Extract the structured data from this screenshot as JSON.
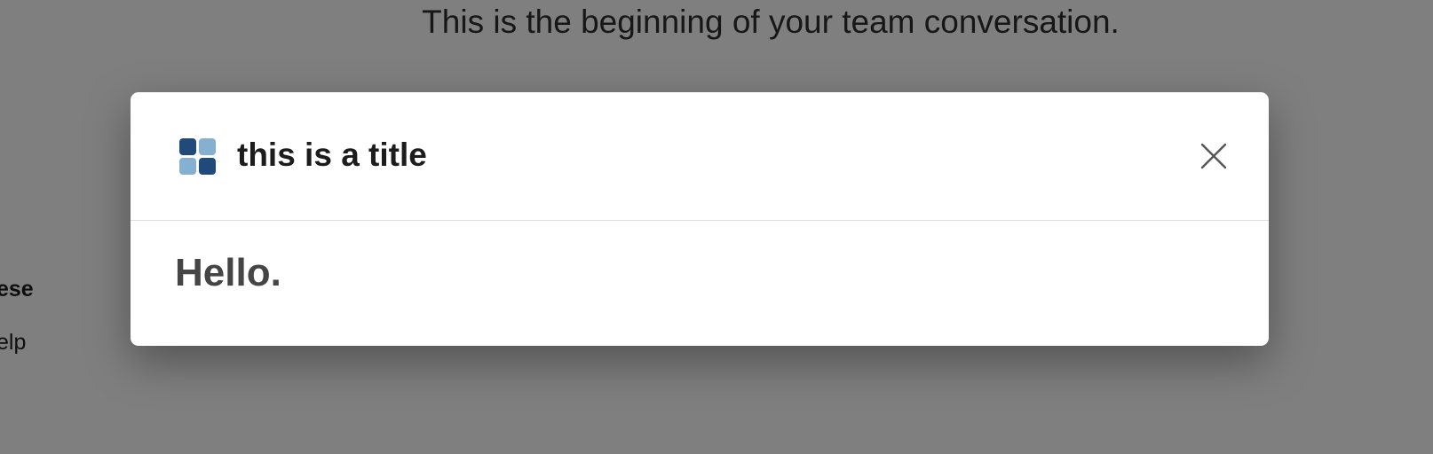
{
  "background": {
    "heading": "This is the beginning of your team conversation.",
    "snippets": [
      "ese",
      "elp"
    ]
  },
  "modal": {
    "icon": "app-grid-icon",
    "title": "this is a title",
    "close_icon": "close-icon",
    "body_text": "Hello."
  },
  "colors": {
    "overlay": "#7a7a7a",
    "icon_dark": "#1f4a7a",
    "icon_light": "#86b0d0",
    "title_text": "#1d1c1d",
    "body_text": "#454545"
  }
}
